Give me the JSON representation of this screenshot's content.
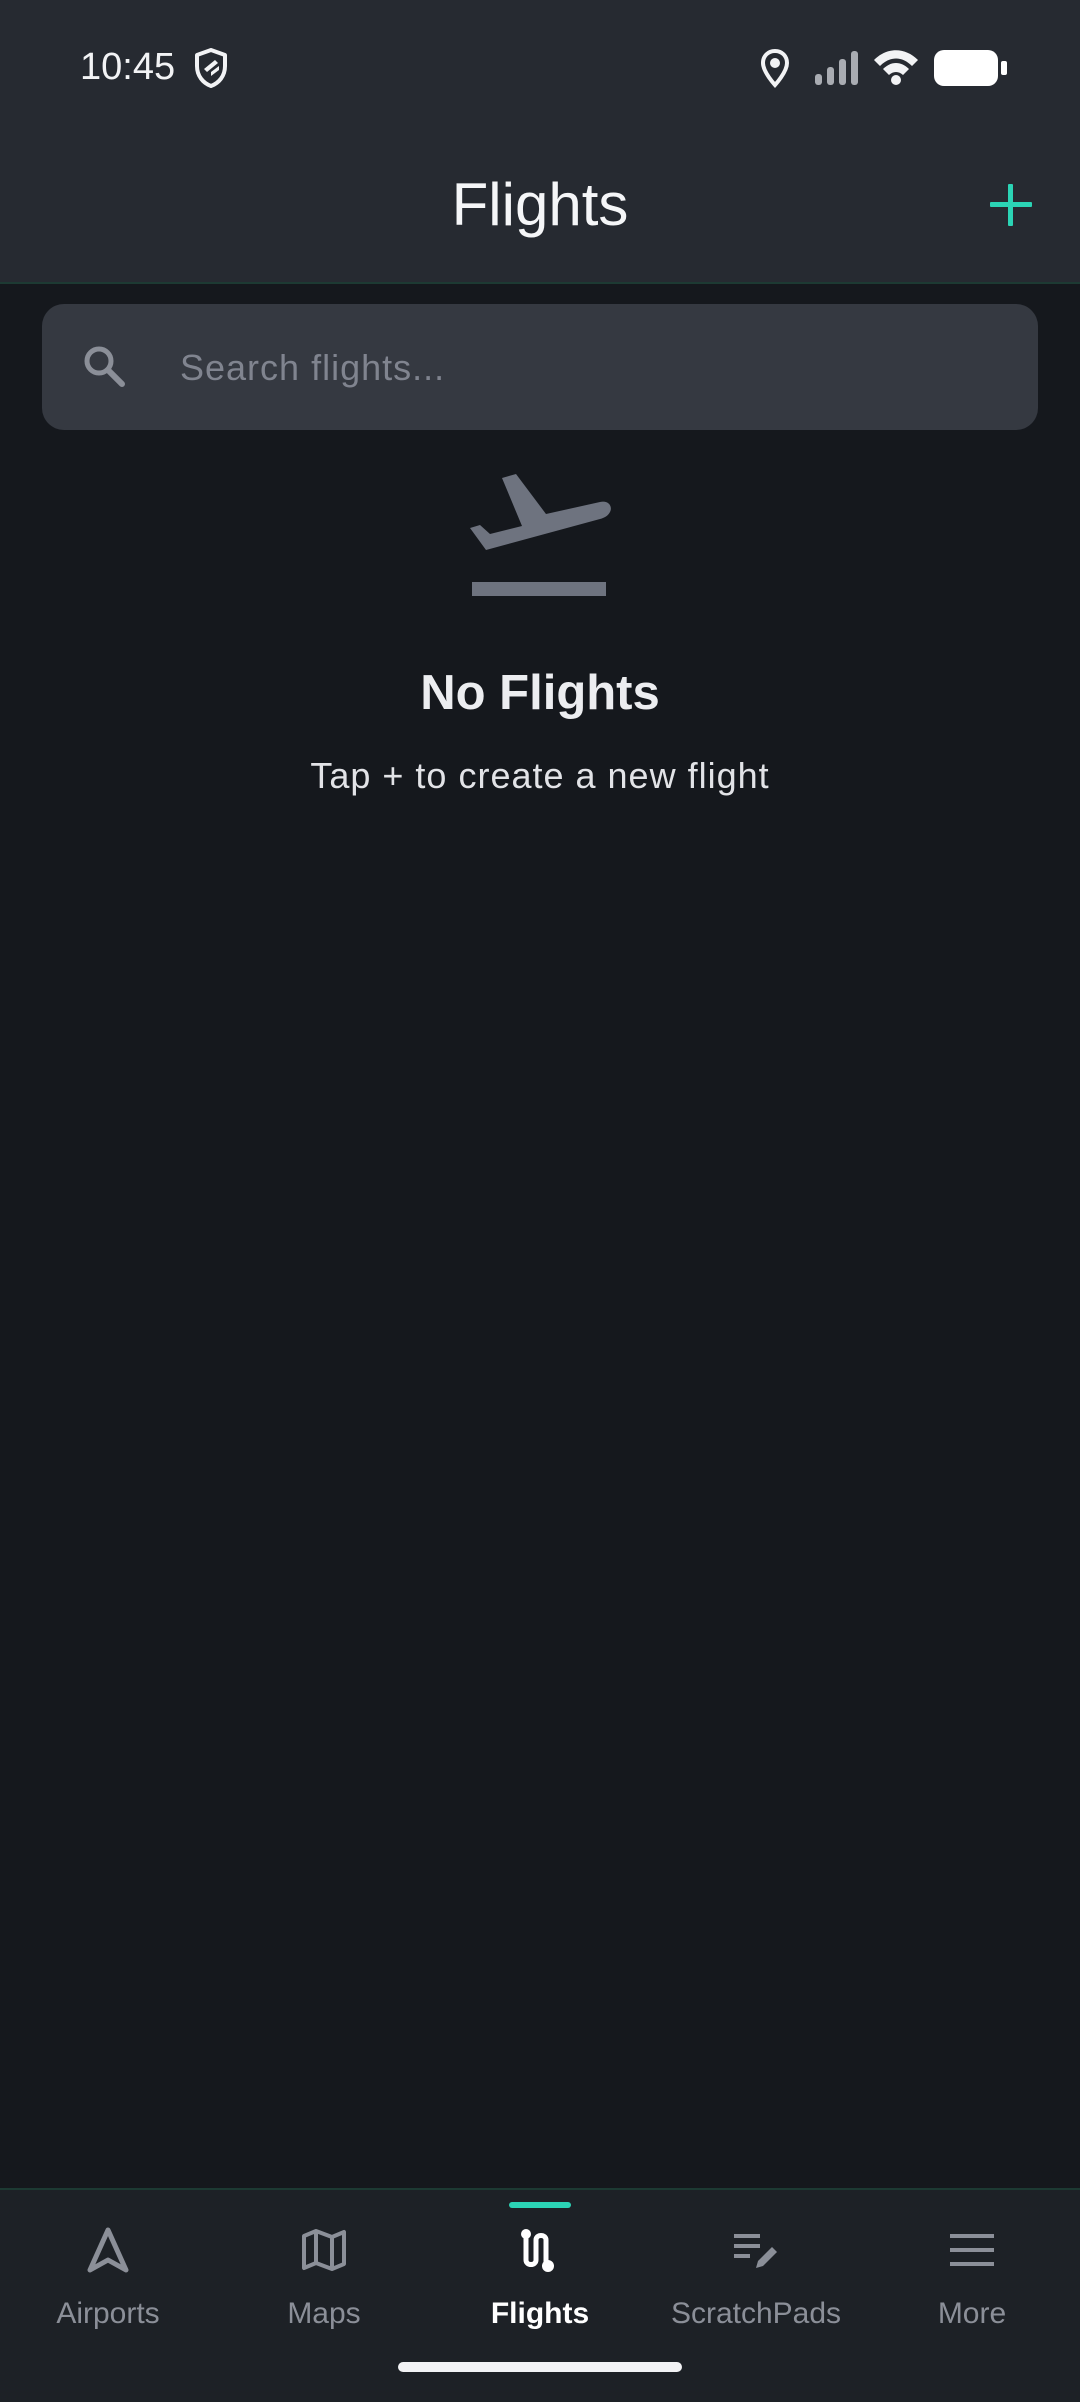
{
  "status_bar": {
    "time": "10:45",
    "icons": [
      "shield-icon",
      "location-icon",
      "signal-icon",
      "wifi-icon",
      "battery-icon"
    ]
  },
  "header": {
    "title": "Flights",
    "add_icon": "plus-icon"
  },
  "search": {
    "placeholder": "Search flights...",
    "value": "",
    "icon": "search-icon"
  },
  "empty_state": {
    "icon": "flight-takeoff-icon",
    "title": "No Flights",
    "subtitle": "Tap + to create a new flight"
  },
  "bottom_nav": {
    "items": [
      {
        "label": "Airports",
        "icon": "navigation-arrow-icon",
        "active": false
      },
      {
        "label": "Maps",
        "icon": "map-icon",
        "active": false
      },
      {
        "label": "Flights",
        "icon": "route-icon",
        "active": true
      },
      {
        "label": "ScratchPads",
        "icon": "edit-note-icon",
        "active": false
      },
      {
        "label": "More",
        "icon": "menu-icon",
        "active": false
      }
    ]
  },
  "colors": {
    "accent": "#2bd4b5",
    "background": "#15181d",
    "header_background": "#262a31",
    "search_background": "#353941",
    "muted": "#8b8f98"
  }
}
